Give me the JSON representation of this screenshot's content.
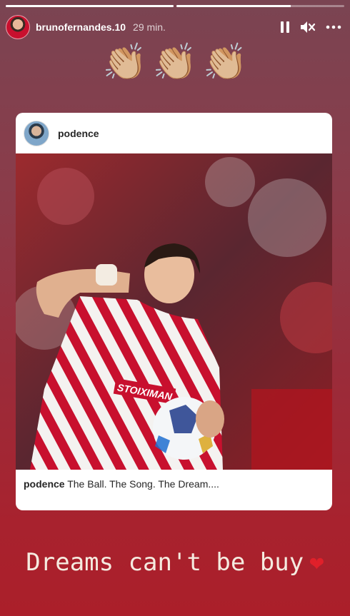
{
  "story": {
    "progress": [
      1.0,
      0.68
    ],
    "username": "brunofernandes.10",
    "time": "29 min.",
    "claps": [
      "👏🏼",
      "👏🏼",
      "👏🏼"
    ]
  },
  "post": {
    "username": "podence",
    "caption_user": "podence",
    "caption_text": "The Ball. The Song. The Dream....",
    "photo_text": "STOIXIMAN"
  },
  "overlay_text": "Dreams can't be buy",
  "overlay_emoji": "❤",
  "colors": {
    "accent_heart": "#e0202a",
    "kit_red": "#c8102e",
    "card_bg": "#ffffff"
  }
}
